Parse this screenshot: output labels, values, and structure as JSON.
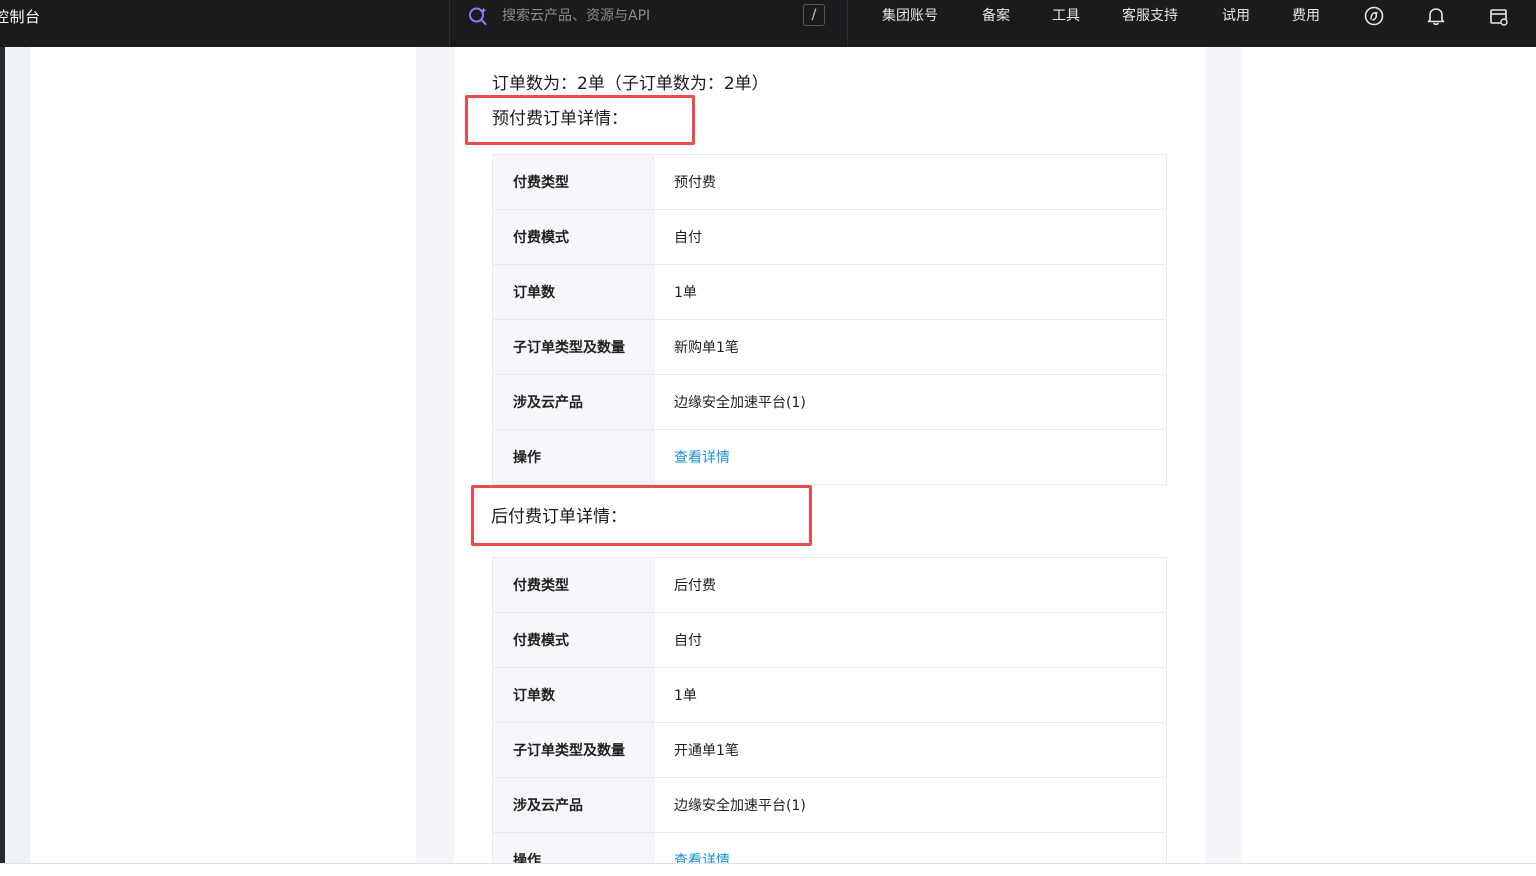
{
  "topbar": {
    "brand": "控制台",
    "search_placeholder": "搜索云产品、资源与API",
    "slash_key": "/",
    "nav": [
      "集团账号",
      "备案",
      "工具",
      "客服支持",
      "试用",
      "费用"
    ],
    "icons": [
      "ai-assistant-icon",
      "bell-icon",
      "settings-panel-icon"
    ]
  },
  "doc": {
    "summary": "订单数为：2单（子订单数为：2单）",
    "prepaid": {
      "title": "预付费订单详情：",
      "rows": [
        {
          "key": "付费类型",
          "value": "预付费"
        },
        {
          "key": "付费模式",
          "value": "自付"
        },
        {
          "key": "订单数",
          "value": "1单"
        },
        {
          "key": "子订单类型及数量",
          "value": "新购单1笔"
        },
        {
          "key": "涉及云产品",
          "value": "边缘安全加速平台(1)"
        },
        {
          "key": "操作",
          "value": "查看详情",
          "link": true
        }
      ]
    },
    "postpaid": {
      "title": "后付费订单详情：",
      "rows": [
        {
          "key": "付费类型",
          "value": "后付费"
        },
        {
          "key": "付费模式",
          "value": "自付"
        },
        {
          "key": "订单数",
          "value": "1单"
        },
        {
          "key": "子订单类型及数量",
          "value": "开通单1笔"
        },
        {
          "key": "涉及云产品",
          "value": "边缘安全加速平台(1)"
        },
        {
          "key": "操作",
          "value": "查看详情",
          "link": true
        }
      ]
    }
  },
  "colors": {
    "topbar_bg": "#1b1b1d",
    "highlight_border": "#e84c4c",
    "link": "#1890d9",
    "key_cell_bg": "#f5f7fa"
  }
}
